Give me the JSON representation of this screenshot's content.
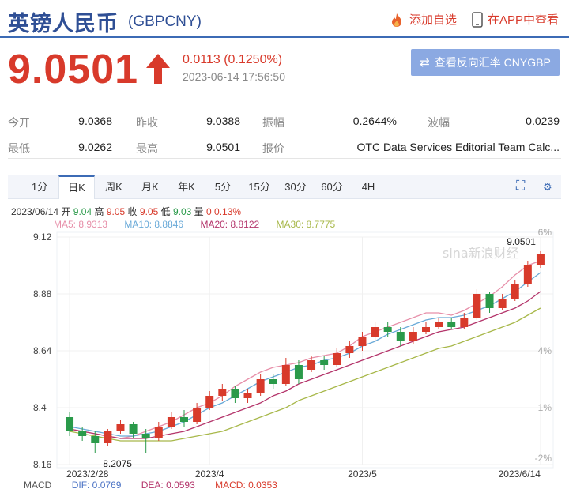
{
  "header": {
    "title": "英镑人民币",
    "symbol": "(GBPCNY)",
    "watchlist_label": "添加自选",
    "app_label": "在APP中查看"
  },
  "quote": {
    "price": "9.0501",
    "change": "0.0113 (0.1250%)",
    "timestamp": "2023-06-14 17:56:50",
    "reverse_label": "查看反向汇率 CNYGBP"
  },
  "stats": [
    {
      "label": "今开",
      "value": "9.0368"
    },
    {
      "label": "昨收",
      "value": "9.0388"
    },
    {
      "label": "振幅",
      "value": "0.2644%"
    },
    {
      "label": "波幅",
      "value": "0.0239"
    },
    {
      "label": "最低",
      "value": "9.0262"
    },
    {
      "label": "最高",
      "value": "9.0501"
    },
    {
      "label": "报价",
      "value": "OTC Data Services Editorial Team Calc..."
    }
  ],
  "tabs": [
    "1分",
    "日K",
    "周K",
    "月K",
    "年K",
    "5分",
    "15分",
    "30分",
    "60分",
    "4H"
  ],
  "active_tab": "日K",
  "ohlc": {
    "date": "2023/06/14",
    "open_label": "开",
    "open": "9.04",
    "high_label": "高",
    "high": "9.05",
    "close_label": "收",
    "close": "9.05",
    "low_label": "低",
    "low": "9.03",
    "vol_label": "量",
    "vol": "0",
    "pct": "0.13%"
  },
  "ma": {
    "ma5": "MA5: 8.9313",
    "ma10": "MA10: 8.8846",
    "ma20": "MA20: 8.8122",
    "ma30": "MA30: 8.7775"
  },
  "macd": {
    "label": "MACD",
    "dif": "DIF: 0.0769",
    "dea": "DEA: 0.0593",
    "macd": "MACD: 0.0353"
  },
  "colors": {
    "up": "#d83a2b",
    "down": "#2a9a4a",
    "ma5": "#e78fa9",
    "ma10": "#6aaad8",
    "ma20": "#b4356b",
    "ma30": "#a8b84a",
    "brand": "#2f4f95"
  },
  "chart_data": {
    "type": "candlestick",
    "y_ticks": [
      "9.12",
      "8.88",
      "8.64",
      "8.4",
      "8.16"
    ],
    "ylim": [
      8.16,
      9.12
    ],
    "right_ticks": [
      "6%",
      "4%",
      "1%",
      "-2%"
    ],
    "x_ticks": [
      "2023/2/28",
      "2023/4",
      "2023/5",
      "2023/6/14"
    ],
    "max_label": "9.0501",
    "min_label": "8.2075",
    "watermark": "sina新浪财经",
    "series": [
      {
        "name": "MA5",
        "values": [
          8.31,
          8.3,
          8.29,
          8.28,
          8.27,
          8.28,
          8.3,
          8.32,
          8.34,
          8.37,
          8.4,
          8.42,
          8.45,
          8.49,
          8.52,
          8.55,
          8.57,
          8.58,
          8.59,
          8.61,
          8.62,
          8.63,
          8.66,
          8.7,
          8.72,
          8.74,
          8.76,
          8.78,
          8.8,
          8.8,
          8.79,
          8.81,
          8.84,
          8.87,
          8.91,
          8.96,
          9.0,
          9.02
        ]
      },
      {
        "name": "MA10",
        "values": [
          8.32,
          8.31,
          8.3,
          8.29,
          8.28,
          8.28,
          8.29,
          8.3,
          8.32,
          8.34,
          8.37,
          8.4,
          8.42,
          8.45,
          8.48,
          8.51,
          8.53,
          8.55,
          8.57,
          8.58,
          8.6,
          8.61,
          8.63,
          8.66,
          8.68,
          8.71,
          8.73,
          8.75,
          8.77,
          8.78,
          8.78,
          8.79,
          8.81,
          8.83,
          8.86,
          8.89,
          8.93,
          8.97
        ]
      },
      {
        "name": "MA20",
        "values": [
          8.31,
          8.3,
          8.29,
          8.28,
          8.27,
          8.27,
          8.27,
          8.28,
          8.29,
          8.3,
          8.32,
          8.34,
          8.36,
          8.38,
          8.4,
          8.42,
          8.45,
          8.47,
          8.5,
          8.52,
          8.54,
          8.56,
          8.58,
          8.6,
          8.62,
          8.64,
          8.66,
          8.68,
          8.7,
          8.72,
          8.73,
          8.74,
          8.76,
          8.78,
          8.8,
          8.82,
          8.85,
          8.89
        ]
      },
      {
        "name": "MA30",
        "values": [
          8.3,
          8.29,
          8.28,
          8.27,
          8.26,
          8.26,
          8.26,
          8.26,
          8.26,
          8.27,
          8.28,
          8.29,
          8.3,
          8.32,
          8.34,
          8.36,
          8.38,
          8.4,
          8.43,
          8.45,
          8.47,
          8.49,
          8.51,
          8.53,
          8.55,
          8.57,
          8.59,
          8.61,
          8.63,
          8.65,
          8.66,
          8.68,
          8.7,
          8.72,
          8.74,
          8.76,
          8.79,
          8.82
        ]
      }
    ],
    "candles": [
      [
        8.36,
        8.3,
        8.38,
        8.28
      ],
      [
        8.3,
        8.28,
        8.32,
        8.26
      ],
      [
        8.28,
        8.25,
        8.3,
        8.21
      ],
      [
        8.25,
        8.3,
        8.31,
        8.24
      ],
      [
        8.3,
        8.33,
        8.35,
        8.29
      ],
      [
        8.33,
        8.29,
        8.34,
        8.27
      ],
      [
        8.29,
        8.27,
        8.31,
        8.21
      ],
      [
        8.27,
        8.32,
        8.34,
        8.26
      ],
      [
        8.32,
        8.36,
        8.38,
        8.31
      ],
      [
        8.36,
        8.34,
        8.39,
        8.32
      ],
      [
        8.34,
        8.4,
        8.42,
        8.33
      ],
      [
        8.4,
        8.45,
        8.47,
        8.39
      ],
      [
        8.45,
        8.48,
        8.5,
        8.43
      ],
      [
        8.48,
        8.44,
        8.49,
        8.42
      ],
      [
        8.44,
        8.46,
        8.48,
        8.42
      ],
      [
        8.46,
        8.52,
        8.54,
        8.45
      ],
      [
        8.52,
        8.5,
        8.54,
        8.48
      ],
      [
        8.5,
        8.58,
        8.61,
        8.49
      ],
      [
        8.58,
        8.52,
        8.6,
        8.5
      ],
      [
        8.56,
        8.6,
        8.62,
        8.55
      ],
      [
        8.6,
        8.58,
        8.62,
        8.56
      ],
      [
        8.58,
        8.63,
        8.65,
        8.57
      ],
      [
        8.63,
        8.66,
        8.68,
        8.61
      ],
      [
        8.66,
        8.7,
        8.72,
        8.64
      ],
      [
        8.7,
        8.74,
        8.76,
        8.68
      ],
      [
        8.74,
        8.72,
        8.76,
        8.7
      ],
      [
        8.72,
        8.68,
        8.74,
        8.66
      ],
      [
        8.68,
        8.72,
        8.74,
        8.67
      ],
      [
        8.72,
        8.74,
        8.76,
        8.71
      ],
      [
        8.74,
        8.76,
        8.78,
        8.73
      ],
      [
        8.76,
        8.74,
        8.78,
        8.73
      ],
      [
        8.74,
        8.78,
        8.8,
        8.73
      ],
      [
        8.78,
        8.88,
        8.9,
        8.77
      ],
      [
        8.88,
        8.82,
        8.89,
        8.8
      ],
      [
        8.82,
        8.86,
        8.88,
        8.81
      ],
      [
        8.86,
        8.92,
        8.94,
        8.85
      ],
      [
        8.92,
        9.0,
        9.02,
        8.91
      ],
      [
        9.0,
        9.05,
        9.06,
        8.99
      ]
    ]
  }
}
